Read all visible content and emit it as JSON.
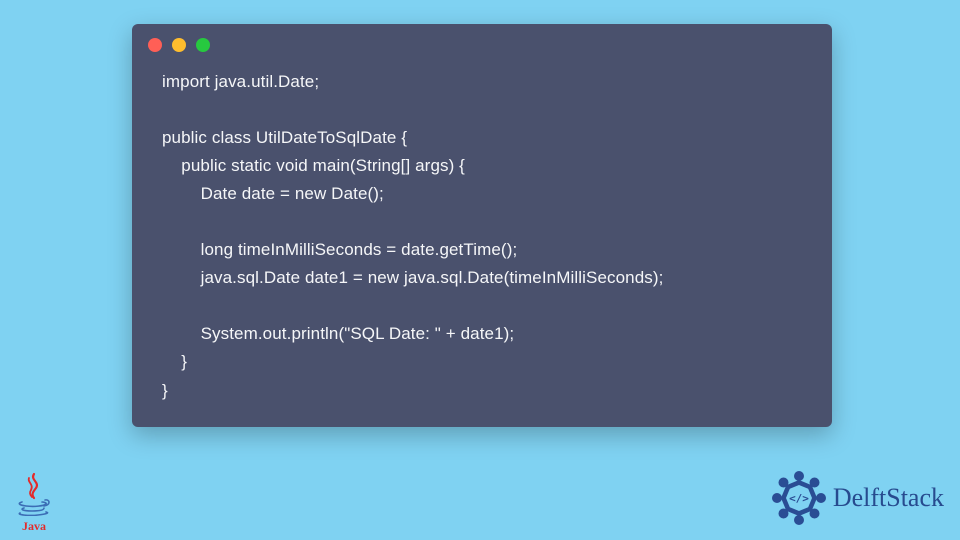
{
  "code": {
    "lines": [
      "import java.util.Date;",
      "",
      "public class UtilDateToSqlDate {",
      "    public static void main(String[] args) {",
      "        Date date = new Date();",
      "",
      "        long timeInMilliSeconds = date.getTime();",
      "        java.sql.Date date1 = new java.sql.Date(timeInMilliSeconds);",
      "",
      "        System.out.println(\"SQL Date: \" + date1);",
      "    }",
      "}"
    ]
  },
  "window": {
    "dots": [
      "red",
      "yellow",
      "green"
    ]
  },
  "logos": {
    "java_label": "Java",
    "delft_label": "DelftStack"
  },
  "colors": {
    "page_bg": "#7fd2f2",
    "window_bg": "#4a516d",
    "code_fg": "#f5f6f8",
    "delft_blue": "#274b8f",
    "java_red": "#e42a2a"
  }
}
